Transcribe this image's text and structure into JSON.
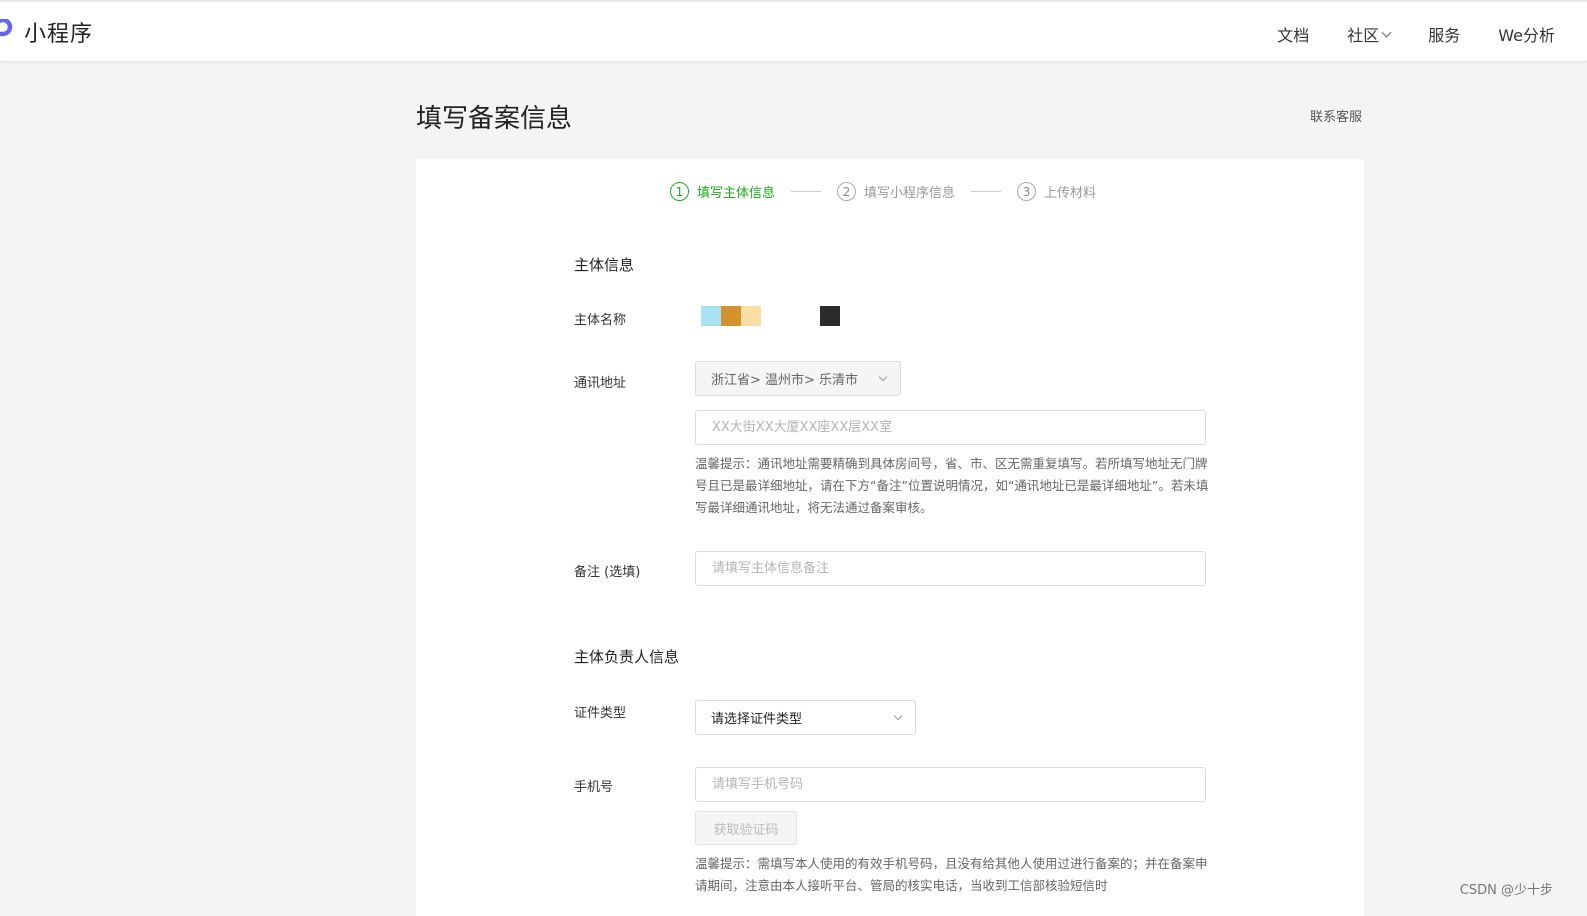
{
  "header": {
    "logo_text": "小程序",
    "nav": [
      {
        "label": "文档"
      },
      {
        "label": "社区",
        "has_dropdown": true
      },
      {
        "label": "服务"
      },
      {
        "label": "We分析"
      }
    ]
  },
  "page": {
    "title": "填写备案信息",
    "contact_link": "联系客服"
  },
  "steps": [
    {
      "num": "1",
      "label": "填写主体信息",
      "active": true
    },
    {
      "num": "2",
      "label": "填写小程序信息",
      "active": false
    },
    {
      "num": "3",
      "label": "上传材料",
      "active": false
    }
  ],
  "subject": {
    "section_title": "主体信息",
    "name_label": "主体名称",
    "address_label": "通讯地址",
    "region_value": "浙江省> 温州市> 乐清市",
    "address_placeholder": "XX大街XX大厦XX座XX层XX室",
    "address_hint": "温馨提示：通讯地址需要精确到具体房间号，省、市、区无需重复填写。若所填写地址无门牌号且已是最详细地址，请在下方“备注”位置说明情况，如“通讯地址已是最详细地址”。若未填写最详细通讯地址，将无法通过备案审核。",
    "remark_label": "备注 (选填)",
    "remark_placeholder": "请填写主体信息备注"
  },
  "principal": {
    "section_title": "主体负责人信息",
    "id_type_label": "证件类型",
    "id_type_value": "请选择证件类型",
    "phone_label": "手机号",
    "phone_placeholder": "请填写手机号码",
    "get_code_button": "获取验证码",
    "phone_hint": "温馨提示：需填写本人使用的有效手机号码，且没有给其他人使用过进行备案的；并在备案申请期间，注意由本人接听平台、管局的核实电话，当收到工信部核验短信时"
  },
  "watermark": "CSDN @少十步",
  "colors": {
    "accent": "#1aad19",
    "logo": "#6467f0",
    "swatch1": "#a8e2f5",
    "swatch2": "#d4922f",
    "swatch3": "#f8dfa4",
    "swatch4": "#2b2b2b"
  }
}
